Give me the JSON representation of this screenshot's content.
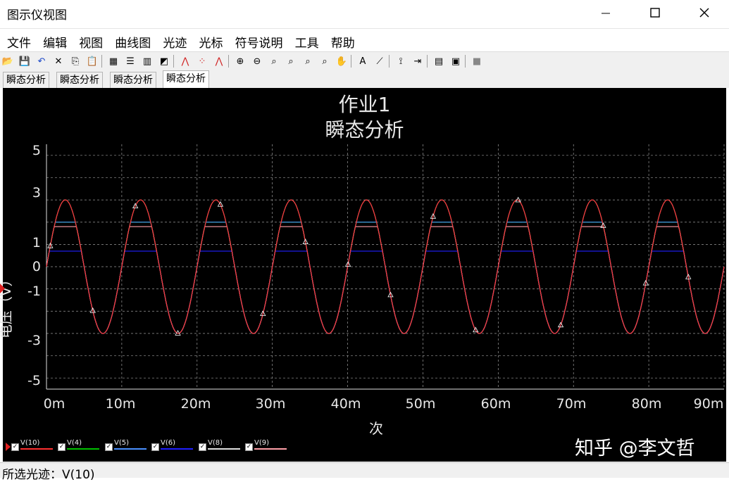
{
  "window": {
    "title": "图示仪视图"
  },
  "menu": [
    "文件",
    "编辑",
    "视图",
    "曲线图",
    "光迹",
    "光标",
    "符号说明",
    "工具",
    "帮助"
  ],
  "toolbar_icons": [
    "open-icon",
    "save-icon",
    "undo-icon",
    "delete-icon",
    "copy-icon",
    "paste-icon",
    "grid-icon",
    "legend-icon",
    "bar-chart-icon",
    "overlay-icon",
    "trace-icon",
    "points-icon",
    "markers-icon",
    "zoom-in-icon",
    "zoom-out-icon",
    "zoom-fit-icon",
    "zoom-x-icon",
    "zoom-y-icon",
    "zoom-full-icon",
    "pan-hand-icon",
    "text-icon",
    "line-style-icon",
    "cursor-icon",
    "export-icon",
    "table-icon",
    "properties-icon",
    "stop-icon"
  ],
  "tabs": [
    "瞬态分析",
    "瞬态分析",
    "瞬态分析",
    "瞬态分析"
  ],
  "chart_data": {
    "type": "line",
    "title": "作业1",
    "subtitle": "瞬态分析",
    "xlabel": "次",
    "ylabel": "电压（V）",
    "x_unit": "s",
    "xlim": [
      0,
      0.09
    ],
    "ylim": [
      -5.5,
      5.5
    ],
    "xticks": [
      "0m",
      "10m",
      "20m",
      "30m",
      "40m",
      "50m",
      "60m",
      "70m",
      "80m",
      "90m"
    ],
    "yticks": [
      "5",
      "3",
      "1",
      "0",
      "-1",
      "-3",
      "-5"
    ],
    "grid": true,
    "legend_position": "bottom-left",
    "series": [
      {
        "name": "V(10)",
        "color": "#ff3030",
        "shape": "sine",
        "frequency_hz": 100,
        "amplitude": 3.0,
        "clip_top": null
      },
      {
        "name": "V(4)",
        "color": "#00c000",
        "shape": "sine",
        "frequency_hz": 100,
        "amplitude": 3.0,
        "clip_top": 2.0
      },
      {
        "name": "V(5)",
        "color": "#4a90ff",
        "shape": "sine",
        "frequency_hz": 100,
        "amplitude": 3.0,
        "clip_top": 2.0
      },
      {
        "name": "V(6)",
        "color": "#2020ff",
        "shape": "sine",
        "frequency_hz": 100,
        "amplitude": 3.0,
        "clip_top": 0.7
      },
      {
        "name": "V(8)",
        "color": "#e0e0e0",
        "shape": "sine",
        "frequency_hz": 100,
        "amplitude": 3.0,
        "clip_top": null
      },
      {
        "name": "V(9)",
        "color": "#ffa0a8",
        "shape": "sine",
        "frequency_hz": 100,
        "amplitude": 3.0,
        "clip_top": 1.8
      }
    ]
  },
  "watermark": "知乎 @李文哲",
  "status": {
    "text": "所选光迹：V(10)"
  }
}
